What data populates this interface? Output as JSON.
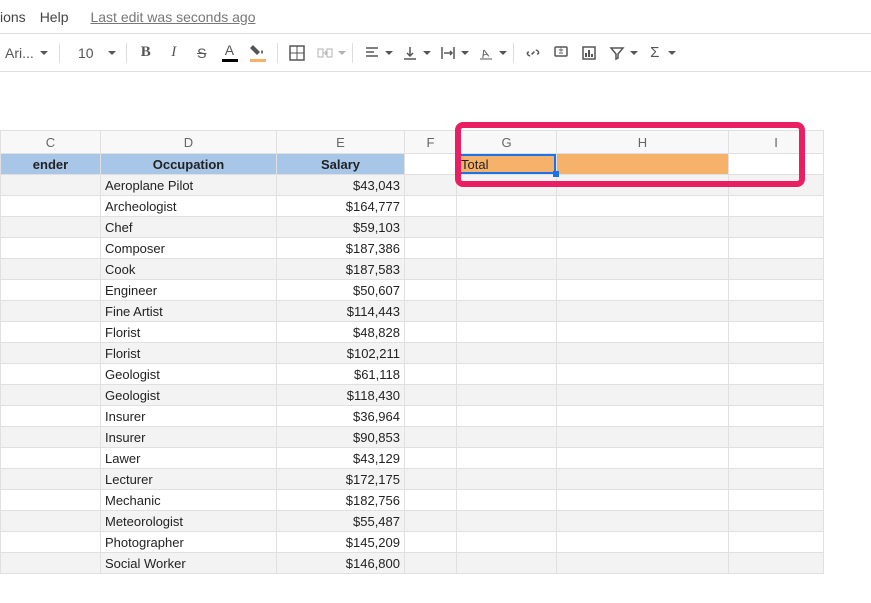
{
  "menubar": {
    "extensions": "ions",
    "help": "Help",
    "edit_status": "Last edit was seconds ago"
  },
  "toolbar": {
    "font_name": "Ari...",
    "font_size": "10"
  },
  "columns": [
    "C",
    "D",
    "E",
    "F",
    "G",
    "H",
    "I"
  ],
  "header_row": {
    "c": "ender",
    "d": "Occupation",
    "e": "Salary"
  },
  "total_label": "Total",
  "data_rows": [
    {
      "occ": "Aeroplane Pilot",
      "sal": "$43,043"
    },
    {
      "occ": "Archeologist",
      "sal": "$164,777"
    },
    {
      "occ": "Chef",
      "sal": "$59,103"
    },
    {
      "occ": "Composer",
      "sal": "$187,386"
    },
    {
      "occ": "Cook",
      "sal": "$187,583"
    },
    {
      "occ": "Engineer",
      "sal": "$50,607"
    },
    {
      "occ": "Fine Artist",
      "sal": "$114,443"
    },
    {
      "occ": "Florist",
      "sal": "$48,828"
    },
    {
      "occ": "Florist",
      "sal": "$102,211"
    },
    {
      "occ": "Geologist",
      "sal": "$61,118"
    },
    {
      "occ": "Geologist",
      "sal": "$118,430"
    },
    {
      "occ": "Insurer",
      "sal": "$36,964"
    },
    {
      "occ": "Insurer",
      "sal": "$90,853"
    },
    {
      "occ": "Lawer",
      "sal": "$43,129"
    },
    {
      "occ": "Lecturer",
      "sal": "$172,175"
    },
    {
      "occ": "Mechanic",
      "sal": "$182,756"
    },
    {
      "occ": "Meteorologist",
      "sal": "$55,487"
    },
    {
      "occ": "Photographer",
      "sal": "$145,209"
    },
    {
      "occ": "Social Worker",
      "sal": "$146,800"
    }
  ],
  "col_widths": {
    "C": 100,
    "D": 176,
    "E": 128,
    "F": 52,
    "G": 100,
    "H": 172,
    "I": 95
  }
}
